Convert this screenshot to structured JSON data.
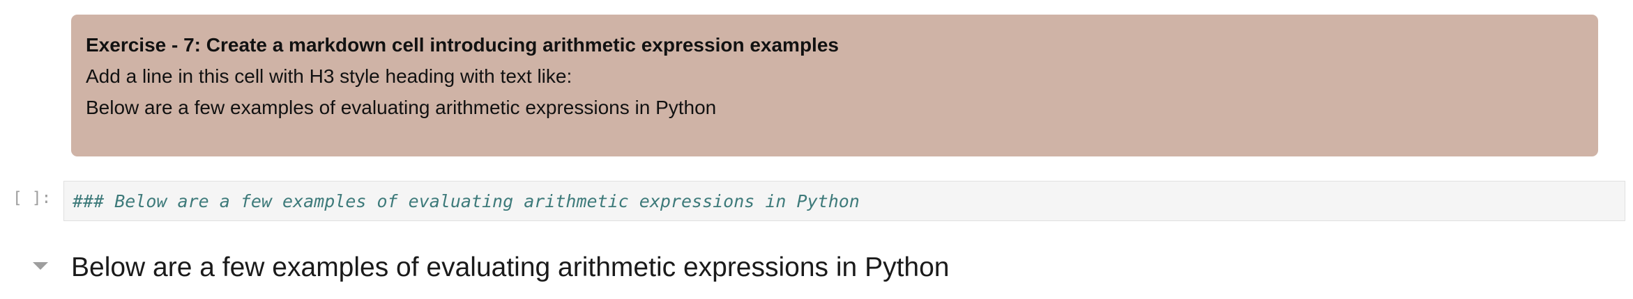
{
  "exercise_cell": {
    "title": "Exercise - 7: Create a markdown cell introducing arithmetic expression examples",
    "lines": [
      "Add a line in this cell with H3 style heading with text like:",
      "Below are a few examples of evaluating arithmetic expressions in Python"
    ],
    "background_color": "#cfb3a6"
  },
  "code_cell": {
    "prompt": "[ ]:",
    "source": "### Below are a few examples of evaluating arithmetic expressions in Python",
    "text_color": "#3d7a7a"
  },
  "rendered_cell": {
    "toggle_icon": "caret-down-icon",
    "heading": "Below are a few examples of evaluating arithmetic expressions in Python"
  }
}
